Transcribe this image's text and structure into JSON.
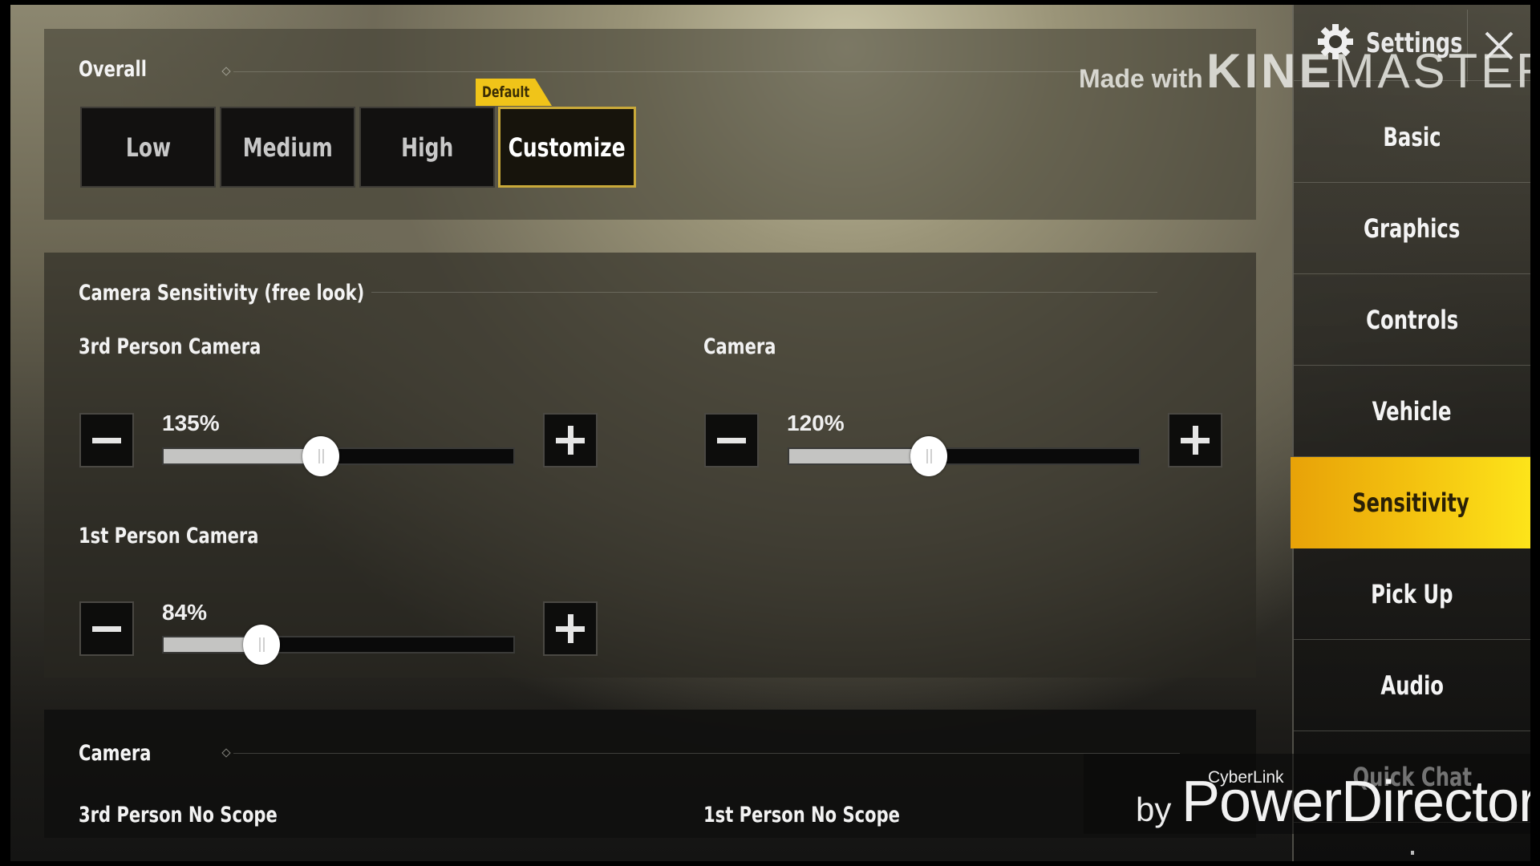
{
  "overall": {
    "title": "Overall",
    "quality_options": [
      {
        "label": "Low",
        "active": false
      },
      {
        "label": "Medium",
        "active": false
      },
      {
        "label": "High",
        "active": false
      },
      {
        "label": "Customize",
        "active": true
      }
    ],
    "default_tag": "Default"
  },
  "camera_sensitivity": {
    "title": "Camera Sensitivity (free look)",
    "slider_range": {
      "min_percent": 0,
      "max_percent": 300
    },
    "sliders": [
      {
        "label": "3rd Person Camera",
        "value_text": "135%",
        "value": 135
      },
      {
        "label": "Camera",
        "value_text": "120%",
        "value": 120
      },
      {
        "label": "1st Person Camera",
        "value_text": "84%",
        "value": 84
      }
    ]
  },
  "camera": {
    "title": "Camera",
    "labels": [
      "3rd Person No Scope",
      "1st Person No Scope"
    ]
  },
  "sidebar": {
    "title": "Settings",
    "items": [
      {
        "label": "Basic",
        "active": false
      },
      {
        "label": "Graphics",
        "active": false
      },
      {
        "label": "Controls",
        "active": false
      },
      {
        "label": "Vehicle",
        "active": false
      },
      {
        "label": "Sensitivity",
        "active": true
      },
      {
        "label": "Pick Up",
        "active": false
      },
      {
        "label": "Audio",
        "active": false
      },
      {
        "label": "Quick Chat",
        "active": false
      }
    ]
  },
  "watermarks": {
    "kinemaster_prefix": "Made with",
    "kinemaster_bold": "KINE",
    "kinemaster_light": "MASTER",
    "powerdirector_small": "CyberLink",
    "powerdirector_by": "by",
    "powerdirector_name": "PowerDirector"
  },
  "colors": {
    "accent_yellow": "#f3c10f",
    "default_tag": "#f0c419",
    "active_border": "#c9a93a"
  }
}
